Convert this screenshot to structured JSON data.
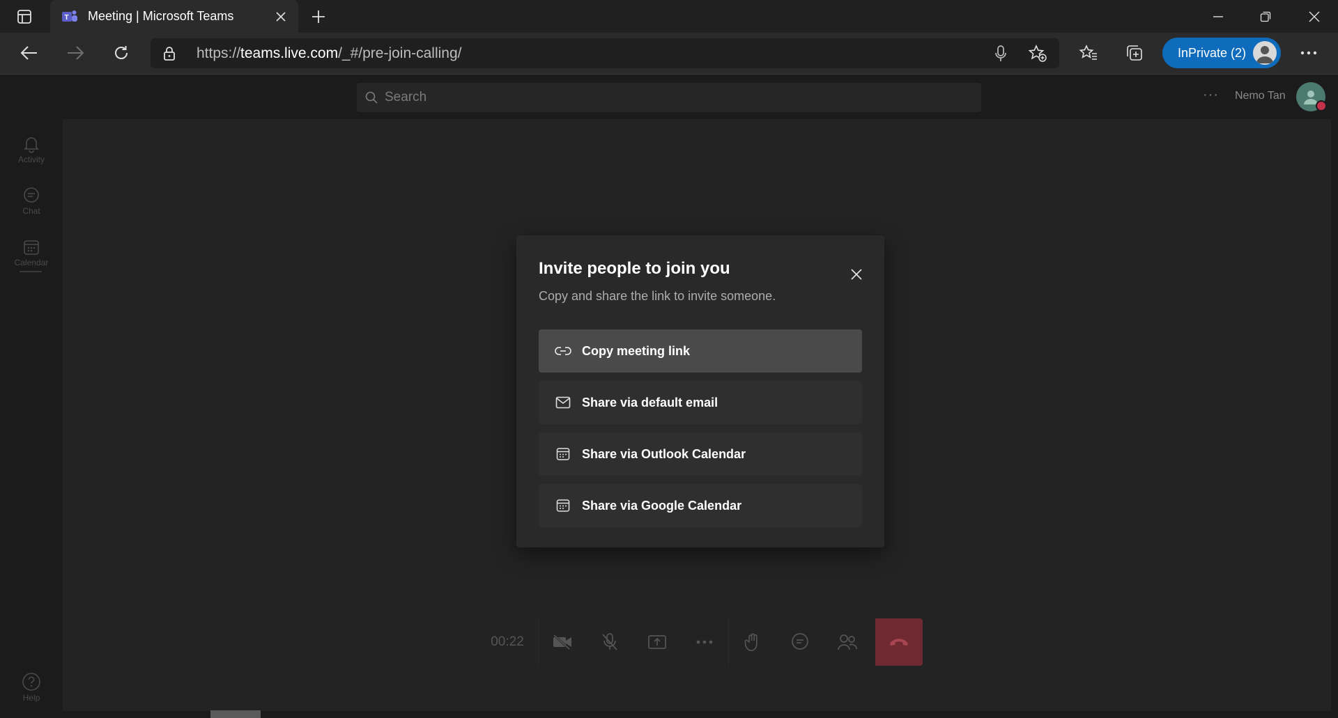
{
  "browser": {
    "tab_title": "Meeting | Microsoft Teams",
    "url_scheme": "https://",
    "url_host": "teams.live.com",
    "url_path": "/_#/pre-join-calling/",
    "inprivate_label": "InPrivate (2)"
  },
  "teams": {
    "search_placeholder": "Search",
    "more_label": "···",
    "user_name": "Nemo Tan",
    "rail": [
      {
        "label": "Activity",
        "icon": "bell-icon"
      },
      {
        "label": "Chat",
        "icon": "chat-icon"
      },
      {
        "label": "Calendar",
        "icon": "calendar-icon"
      }
    ],
    "help_label": "Help",
    "call_timer": "00:22"
  },
  "dialog": {
    "title": "Invite people to join you",
    "subtitle": "Copy and share the link to invite someone.",
    "options": [
      {
        "label": "Copy meeting link",
        "icon": "link-icon"
      },
      {
        "label": "Share via default email",
        "icon": "mail-icon"
      },
      {
        "label": "Share via Outlook Calendar",
        "icon": "calendar-icon"
      },
      {
        "label": "Share via Google Calendar",
        "icon": "calendar-icon"
      }
    ]
  },
  "colors": {
    "accent": "#0f6cbd",
    "hangup": "#c4314b",
    "dialog_bg": "#292929"
  }
}
